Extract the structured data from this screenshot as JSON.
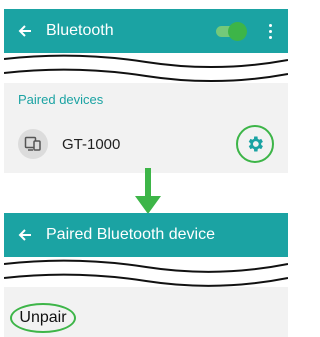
{
  "colors": {
    "appbar": "#1ba3a3",
    "accent_green": "#3db548",
    "section_header": "#1ba3a3",
    "panel_bg": "#f2f2f2"
  },
  "screen1": {
    "appbar": {
      "back_icon": "arrow-left-icon",
      "title": "Bluetooth",
      "toggle_state": "on",
      "menu_icon": "more-vert-icon"
    },
    "section_header": "Paired devices",
    "device": {
      "icon": "devices-icon",
      "name": "GT-1000",
      "settings_icon": "gear-icon"
    }
  },
  "transition_icon": "arrow-down-icon",
  "screen2": {
    "appbar": {
      "back_icon": "arrow-left-icon",
      "title": "Paired Bluetooth device"
    },
    "unpair_label": "Unpair"
  }
}
